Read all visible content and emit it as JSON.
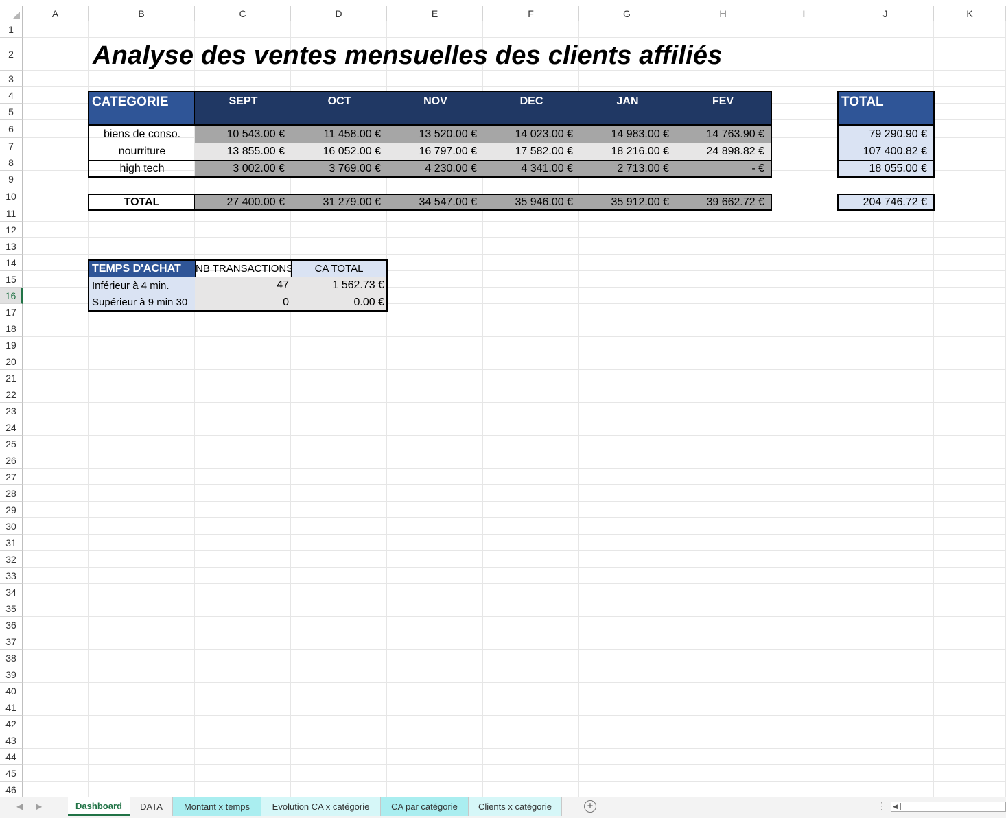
{
  "columns": [
    "A",
    "B",
    "C",
    "D",
    "E",
    "F",
    "G",
    "H",
    "I",
    "J",
    "K"
  ],
  "rows": [
    "1",
    "2",
    "3",
    "4",
    "5",
    "6",
    "7",
    "8",
    "9",
    "10",
    "11",
    "12",
    "13",
    "14",
    "15",
    "16",
    "17",
    "18",
    "19",
    "20",
    "21",
    "22",
    "23",
    "24",
    "25",
    "26",
    "27",
    "28",
    "29",
    "30",
    "31",
    "32",
    "33",
    "34",
    "35",
    "36",
    "37",
    "38",
    "39",
    "40",
    "41",
    "42",
    "43",
    "44",
    "45",
    "46"
  ],
  "selected_row": "16",
  "title": "Analyse des ventes mensuelles des clients affiliés",
  "main_table": {
    "category_header": "CATEGORIE",
    "months": [
      "SEPT",
      "OCT",
      "NOV",
      "DEC",
      "JAN",
      "FEV"
    ],
    "rows": [
      {
        "label": "biens de conso.",
        "values": [
          "10 543.00 €",
          "11 458.00 €",
          "13 520.00 €",
          "14 023.00 €",
          "14 983.00 €",
          "14 763.90 €"
        ]
      },
      {
        "label": "nourriture",
        "values": [
          "13 855.00 €",
          "16 052.00 €",
          "16 797.00 €",
          "17 582.00 €",
          "18 216.00 €",
          "24 898.82 €"
        ]
      },
      {
        "label": "high tech",
        "values": [
          "3 002.00 €",
          "3 769.00 €",
          "4 230.00 €",
          "4 341.00 €",
          "2 713.00 €",
          "-      €"
        ]
      }
    ],
    "total_label": "TOTAL",
    "totals": [
      "27 400.00 €",
      "31 279.00 €",
      "34 547.00 €",
      "35 946.00 €",
      "35 912.00 €",
      "39 662.72 €"
    ]
  },
  "total_table": {
    "header": "TOTAL",
    "values": [
      "79 290.90 €",
      "107 400.82 €",
      "18 055.00 €"
    ],
    "grand_total": "204 746.72 €"
  },
  "time_table": {
    "header": "TEMPS D'ACHAT",
    "col1": "NB TRANSACTIONS",
    "col2": "CA TOTAL",
    "rows": [
      {
        "label": "Inférieur à 4 min.",
        "nb": "47",
        "ca": "1 562.73 €"
      },
      {
        "label": "Supérieur à 9 min 30",
        "nb": "0",
        "ca": "0.00 €"
      }
    ]
  },
  "tabs": [
    {
      "label": "Dashboard",
      "state": "active"
    },
    {
      "label": "DATA",
      "state": "normal"
    },
    {
      "label": "Montant x temps",
      "state": "teal"
    },
    {
      "label": "Evolution CA x catégorie",
      "state": "lteal"
    },
    {
      "label": "CA par catégorie",
      "state": "teal"
    },
    {
      "label": "Clients x catégorie",
      "state": "lteal"
    }
  ],
  "colors": {
    "header_dark": "#203864",
    "header_blue": "#2f5597",
    "gray_dark": "#a6a6a6",
    "gray_light": "#e7e6e6",
    "light_blue": "#dae3f3",
    "excel_green": "#217346"
  }
}
